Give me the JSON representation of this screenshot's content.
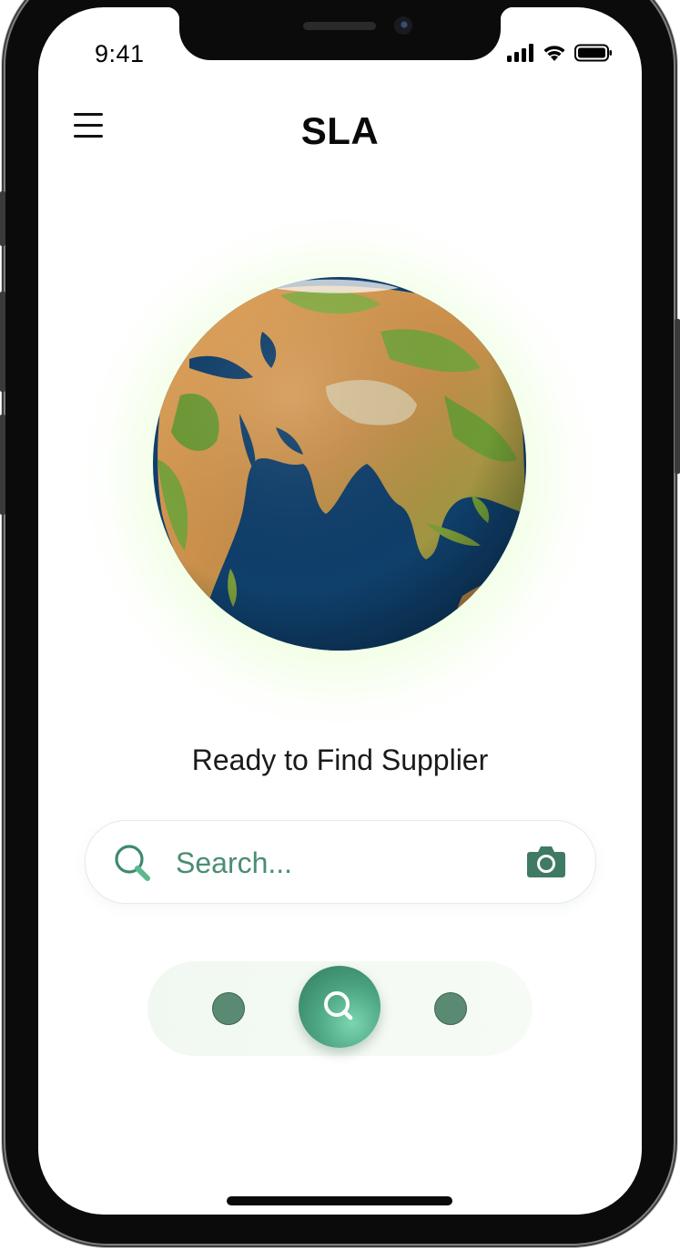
{
  "status_bar": {
    "time": "9:41"
  },
  "header": {
    "title": "SLA"
  },
  "main": {
    "tagline": "Ready to Find Supplier"
  },
  "search": {
    "placeholder": "Search..."
  },
  "icons": {
    "menu": "hamburger-menu-icon",
    "search": "magnifier-icon",
    "camera": "camera-icon",
    "signal": "cellular-signal-icon",
    "wifi": "wifi-icon",
    "battery": "battery-icon",
    "nav_center": "magnifier-icon"
  },
  "colors": {
    "accent_green": "#3e8a6c",
    "nav_dot": "#5b8a72",
    "glow": "#b4ff78",
    "ocean": "#0f3f6b"
  }
}
